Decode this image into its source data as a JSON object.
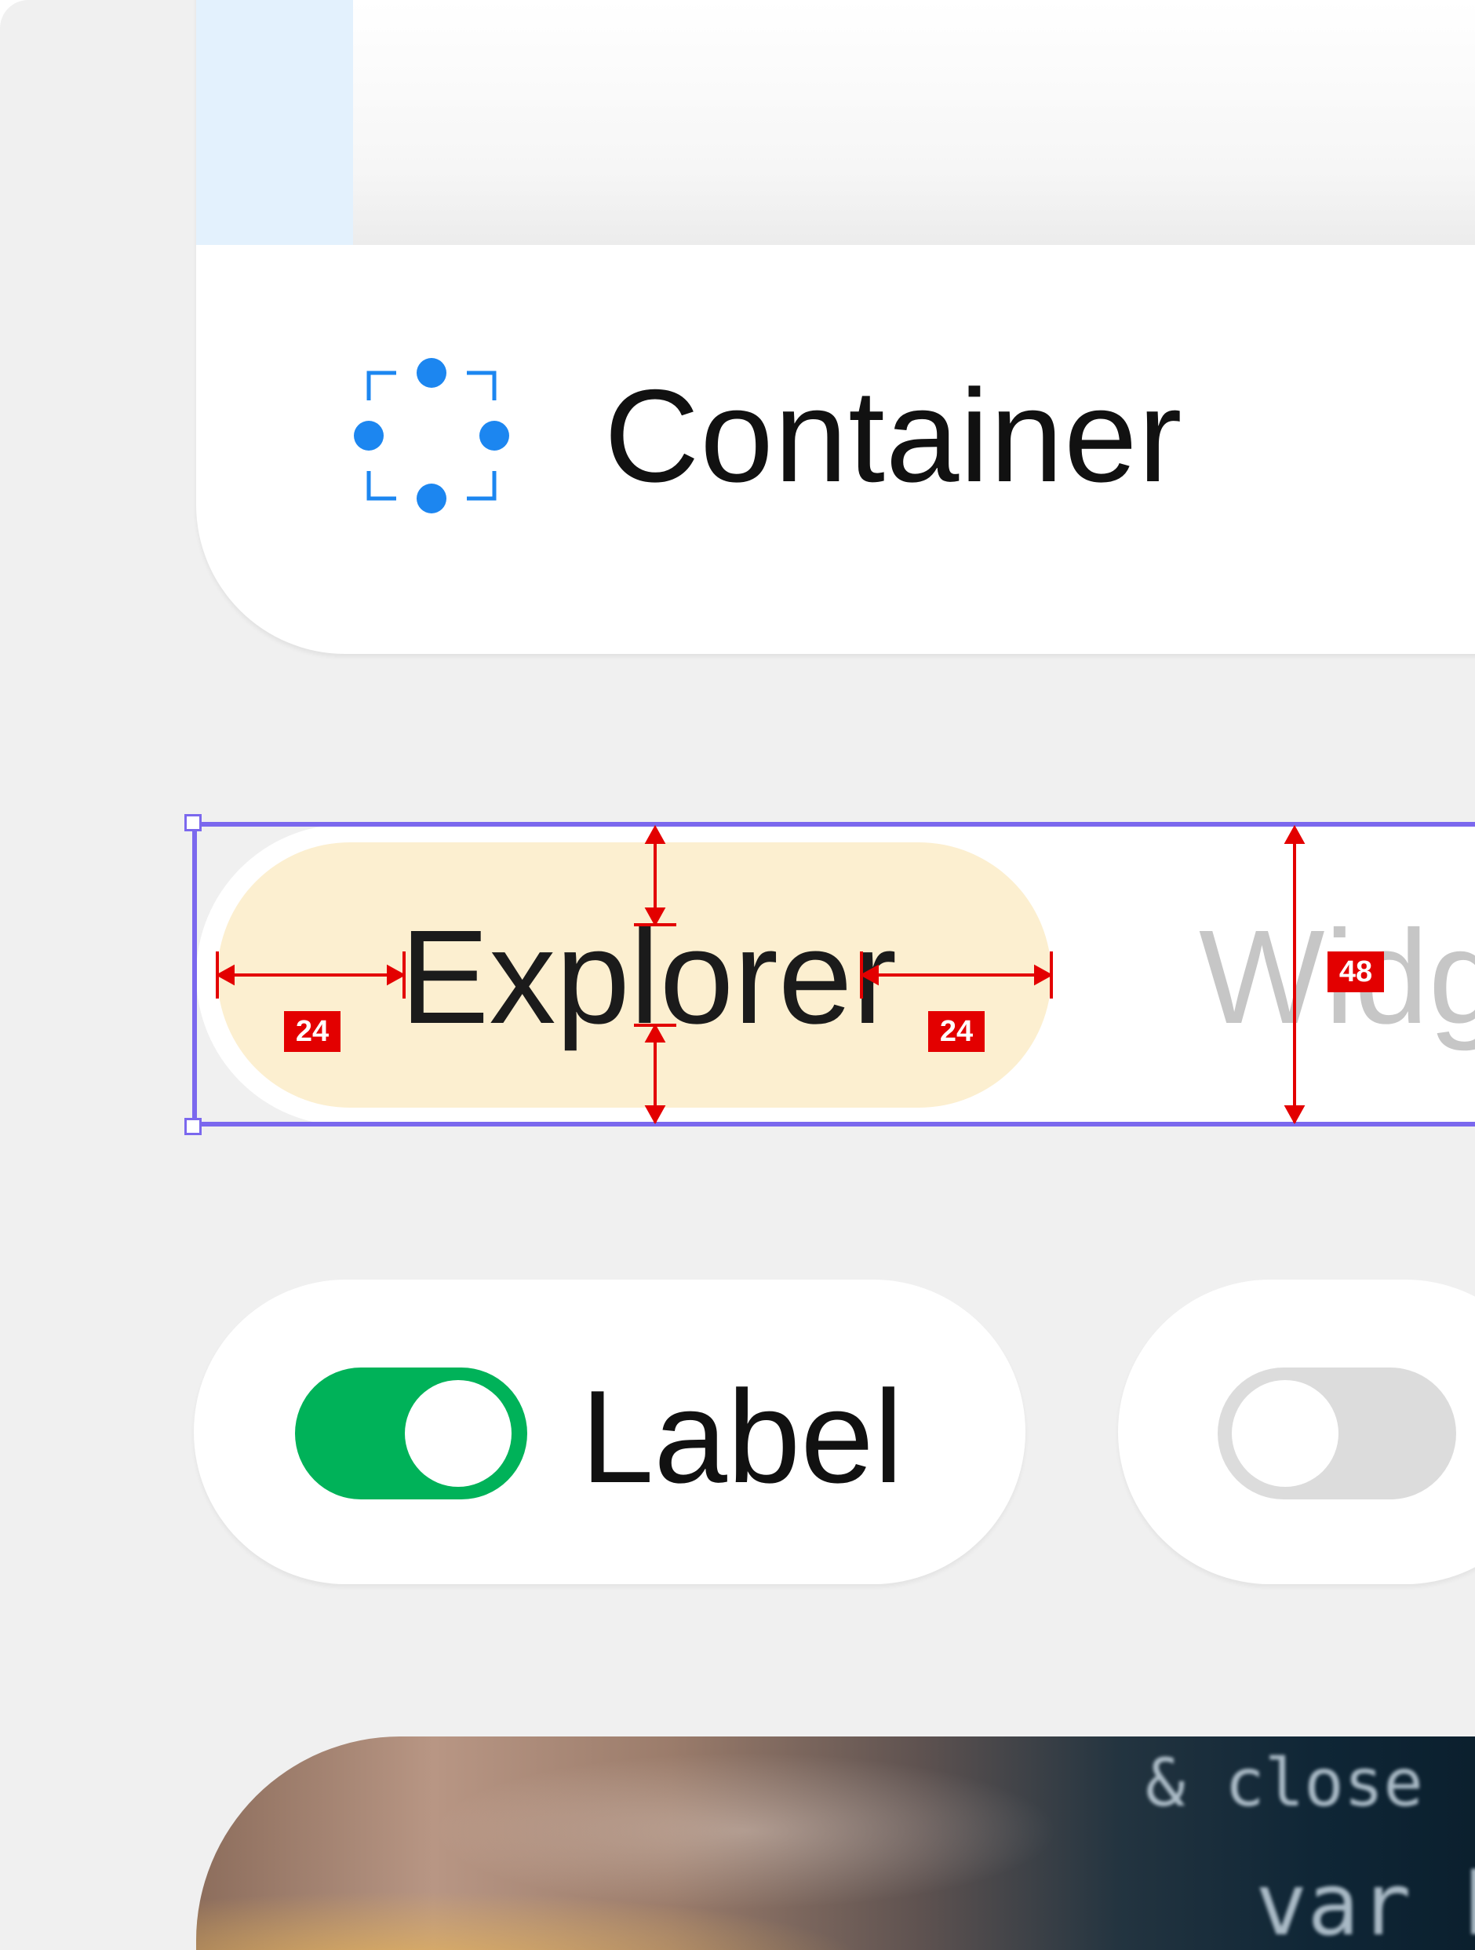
{
  "container_card": {
    "label": "Container",
    "icon": "container-placeholder-icon",
    "accent_color": "#1c86f0"
  },
  "nav_bar": {
    "selected_tab": "Explorer",
    "next_tab": "Widg",
    "selected_color": "#fcefd0",
    "selection_color": "#7b68ee"
  },
  "measurements": {
    "left_padding": "24",
    "right_padding": "24",
    "height": "48",
    "color": "#e30000"
  },
  "toggles": {
    "on_label": "Label",
    "on_color": "#00b259",
    "off_color": "#dcdcdc"
  },
  "photo": {
    "code_line_1": "& close",
    "code_line_2": "var b"
  }
}
